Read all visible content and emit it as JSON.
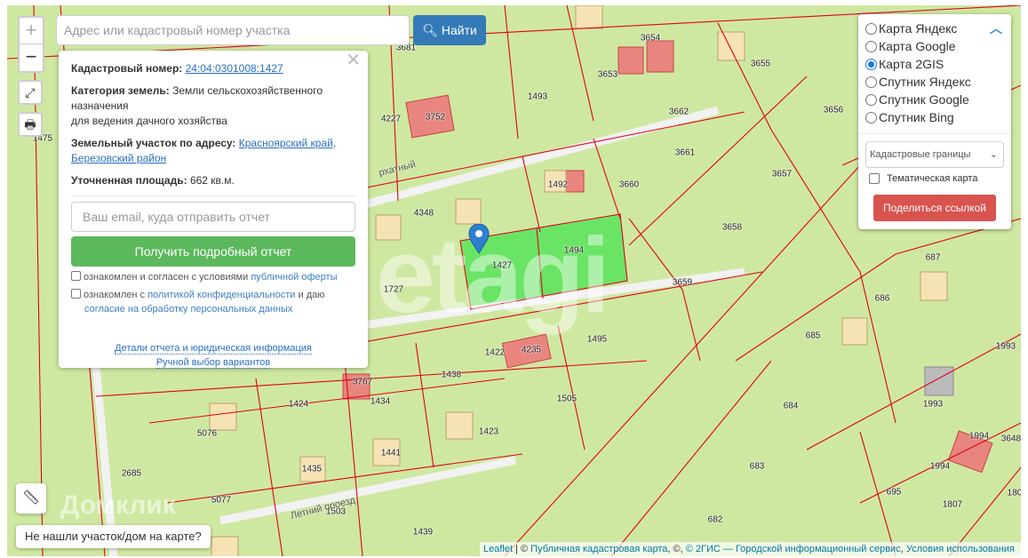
{
  "search": {
    "placeholder": "Адрес или кадастровый номер участка",
    "button": "Найти"
  },
  "zoom": {
    "in": "+",
    "out": "−"
  },
  "popup": {
    "cadastral_label": "Кадастровый номер:",
    "cadastral_value": "24:04:0301008:1427",
    "category_label": "Категория земель:",
    "category_value": "Земли сельскохозяйственного назначения",
    "category_use": "для ведения дачного хозяйства",
    "address_label": "Земельный участок по адресу:",
    "address_value": "Красноярский край, Березовский район",
    "area_label": "Уточненная площадь:",
    "area_value": "662 кв.м.",
    "email_placeholder": "Ваш email, куда отправить отчет",
    "get_report": "Получить подробный отчет",
    "agree1_text": "ознакомлен и согласен с условиями ",
    "agree1_link": "публичной оферты",
    "agree2_text": "ознакомлен с ",
    "agree2_link": "политикой конфиденциальности",
    "agree2_mid": " и даю",
    "agree2_link2": "согласие на обработку персональных данных",
    "details_link": "Детали отчета и юридическая информация",
    "manual_link": "Ручной выбор вариантов"
  },
  "layers": {
    "options": [
      "Карта Яндекс",
      "Карта Google",
      "Карта 2GIS",
      "Спутник Яндекс",
      "Спутник Google",
      "Спутник Bing"
    ],
    "selected": "Карта 2GIS",
    "overlay_select": "Кадастровые границы",
    "thematic": "Тематическая карта",
    "share": "Поделиться ссылкой"
  },
  "not_found": "Не нашли участок/дом на карте?",
  "attribution": {
    "leaflet": "Leaflet",
    "sep": " | © ",
    "pkk": "Публичная кадастровая карта",
    "mid": ", ©, ",
    "gis": "© 2ГИС — Городской информационный сервис",
    "terms": "Условия использования"
  },
  "map": {
    "parcels": [
      "3681",
      "3654",
      "3653",
      "3655",
      "1493",
      "4227",
      "3752",
      "3662",
      "3656",
      "3661",
      "3657",
      "1492",
      "3660",
      "4348",
      "3658",
      "1427",
      "1494",
      "1727",
      "3659",
      "687",
      "686",
      "685",
      "1495",
      "1422",
      "4235",
      "1993",
      "1438",
      "3767",
      "1434",
      "1424",
      "1505",
      "684",
      "1993",
      "5076",
      "1423",
      "1994",
      "3648",
      "1441",
      "1435",
      "683",
      "2685",
      "1994",
      "5077",
      "1503",
      "695",
      "1807",
      "180",
      "682",
      "1439",
      "1475"
    ],
    "streets": [
      "Летний проезд",
      "рхатный"
    ],
    "watermark": "etagi",
    "logo": "Домклик"
  },
  "colors": {
    "accent": "#337ab7",
    "green": "#5cb85c",
    "red": "#d9534f",
    "selected_parcel": "#5ee35e"
  }
}
